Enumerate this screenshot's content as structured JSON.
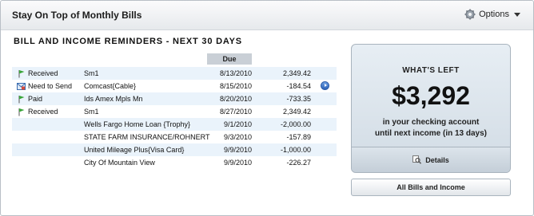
{
  "header": {
    "title": "Stay On Top of Monthly Bills",
    "options_label": "Options"
  },
  "section_title": "BILL AND INCOME REMINDERS - NEXT 30 DAYS",
  "columns": {
    "due": "Due"
  },
  "rows": [
    {
      "status": "Received",
      "status_icon": "green-flag-icon",
      "payee": "Sm1",
      "date": "8/13/2010",
      "amount": "2,349.42"
    },
    {
      "status": "Need to Send",
      "status_icon": "send-payment-icon",
      "payee": "Comcast{Cable}",
      "date": "8/15/2010",
      "amount": "-184.54",
      "action_icon": "blue-arrow-icon"
    },
    {
      "status": "Paid",
      "status_icon": "green-flag-icon",
      "payee": "Ids Amex Mpls Mn",
      "date": "8/20/2010",
      "amount": "-733.35"
    },
    {
      "status": "Received",
      "status_icon": "green-flag-icon",
      "payee": "Sm1",
      "date": "8/27/2010",
      "amount": "2,349.42"
    },
    {
      "status": "",
      "payee": "Wells Fargo Home Loan {Trophy}",
      "date": "9/1/2010",
      "amount": "-2,000.00"
    },
    {
      "status": "",
      "payee": "STATE FARM INSURANCE/ROHNERT",
      "date": "9/3/2010",
      "amount": "-157.89"
    },
    {
      "status": "",
      "payee": "United Mileage Plus{Visa Card}",
      "date": "9/9/2010",
      "amount": "-1,000.00"
    },
    {
      "status": "",
      "payee": "City Of Mountain View",
      "date": "9/9/2010",
      "amount": "-226.27"
    }
  ],
  "panel": {
    "heading": "WHAT'S LEFT",
    "amount": "$3,292",
    "line1": "in your checking account",
    "line2": "until next income (in 13 days)",
    "details_label": "Details"
  },
  "all_button_label": "All Bills and Income"
}
